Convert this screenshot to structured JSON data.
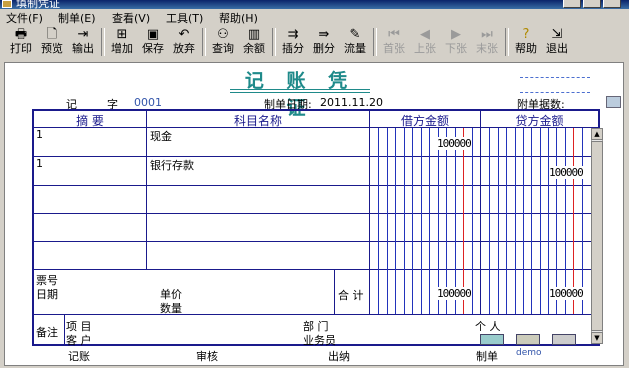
{
  "window": {
    "title": "填制凭证"
  },
  "menu": [
    "文件(F)",
    "制单(E)",
    "查看(V)",
    "工具(T)",
    "帮助(H)"
  ],
  "toolbar": {
    "print": "打印",
    "preview": "预览",
    "export": "输出",
    "add": "增加",
    "save": "保存",
    "discard": "放弃",
    "query": "查询",
    "balance": "余额",
    "insert_line": "插分",
    "delete_line": "删分",
    "flow": "流量",
    "first": "首张",
    "prev": "上张",
    "next": "下张",
    "last": "末张",
    "help": "帮助",
    "exit": "退出"
  },
  "voucher": {
    "title": "记 账 凭 证",
    "type_label": "记",
    "word_label": "字",
    "number": "0001",
    "date_label": "制单日期:",
    "date": "2011.11.20",
    "attach_label": "附单据数:",
    "columns": {
      "summary": "摘 要",
      "account": "科目名称",
      "debit": "借方金额",
      "credit": "贷方金额"
    },
    "rows": [
      {
        "summary": "1",
        "account": "现金",
        "debit": "100000",
        "credit": ""
      },
      {
        "summary": "1",
        "account": "银行存款",
        "debit": "",
        "credit": "100000"
      },
      {
        "summary": "",
        "account": "",
        "debit": "",
        "credit": ""
      },
      {
        "summary": "",
        "account": "",
        "debit": "",
        "credit": ""
      },
      {
        "summary": "",
        "account": "",
        "debit": "",
        "credit": ""
      }
    ],
    "ticket_no_label": "票号",
    "ticket_date_label": "日期",
    "unit_price_label": "单价",
    "quantity_label": "数量",
    "total_label": "合 计",
    "total_debit": "100000",
    "total_credit": "100000",
    "note_label": "备注",
    "project_label": "项 目",
    "customer_label": "客 户",
    "department_label": "部 门",
    "salesman_label": "业务员",
    "person_label": "个 人"
  },
  "footer": {
    "bookkeeper_label": "记账",
    "reviewer_label": "审核",
    "cashier_label": "出纳",
    "maker_label": "制单",
    "maker": "demo"
  }
}
